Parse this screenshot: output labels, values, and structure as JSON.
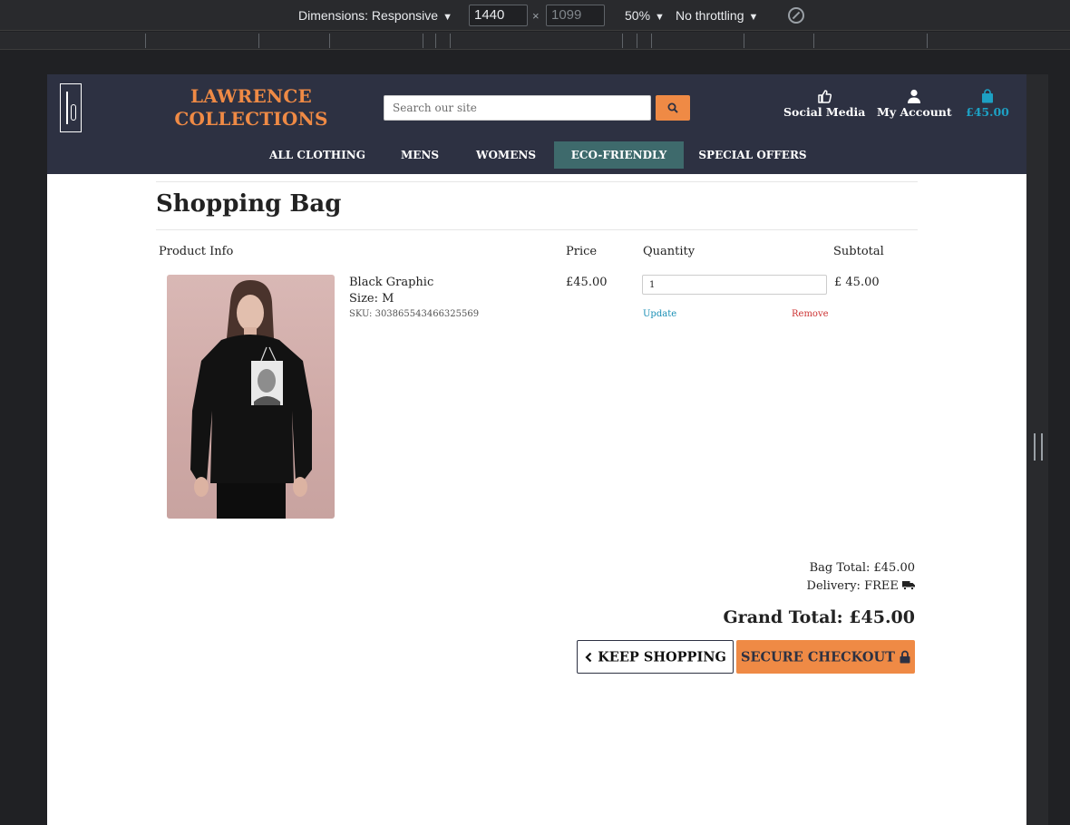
{
  "devtools": {
    "dimensions_label": "Dimensions: Responsive",
    "width_value": "1440",
    "height_value": "1099",
    "zoom_label": "50%",
    "throttle_label": "No throttling",
    "rotate_icon": "rotate-icon"
  },
  "header": {
    "brand_line1": "LAWRENCE",
    "brand_line2": "COLLECTIONS",
    "search_placeholder": "Search our site",
    "social_label": "Social Media",
    "account_label": "My Account",
    "cart_total": "£45.00"
  },
  "nav": {
    "items": [
      "ALL CLOTHING",
      "MENS",
      "WOMENS",
      "ECO-FRIENDLY",
      "SPECIAL OFFERS"
    ],
    "active": "ECO-FRIENDLY"
  },
  "bag": {
    "title": "Shopping Bag",
    "headers": {
      "product": "Product Info",
      "price": "Price",
      "quantity": "Quantity",
      "subtotal": "Subtotal"
    },
    "item": {
      "name": "Black Graphic",
      "size": "Size: M",
      "sku": "SKU: 303865543466325569",
      "price": "£45.00",
      "quantity": "1",
      "update_label": "Update",
      "remove_label": "Remove",
      "subtotal": "£ 45.00"
    },
    "bag_total": "Bag Total: £45.00",
    "delivery": "Delivery: FREE",
    "grand_total": "Grand Total: £45.00",
    "keep_shopping_label": "KEEP SHOPPING",
    "secure_checkout_label": "SECURE CHECKOUT"
  },
  "colors": {
    "header_bg": "#2d3142",
    "accent_orange": "#ef8a45",
    "active_nav": "#3e6a6c",
    "cart_blue": "#1da0c3"
  }
}
